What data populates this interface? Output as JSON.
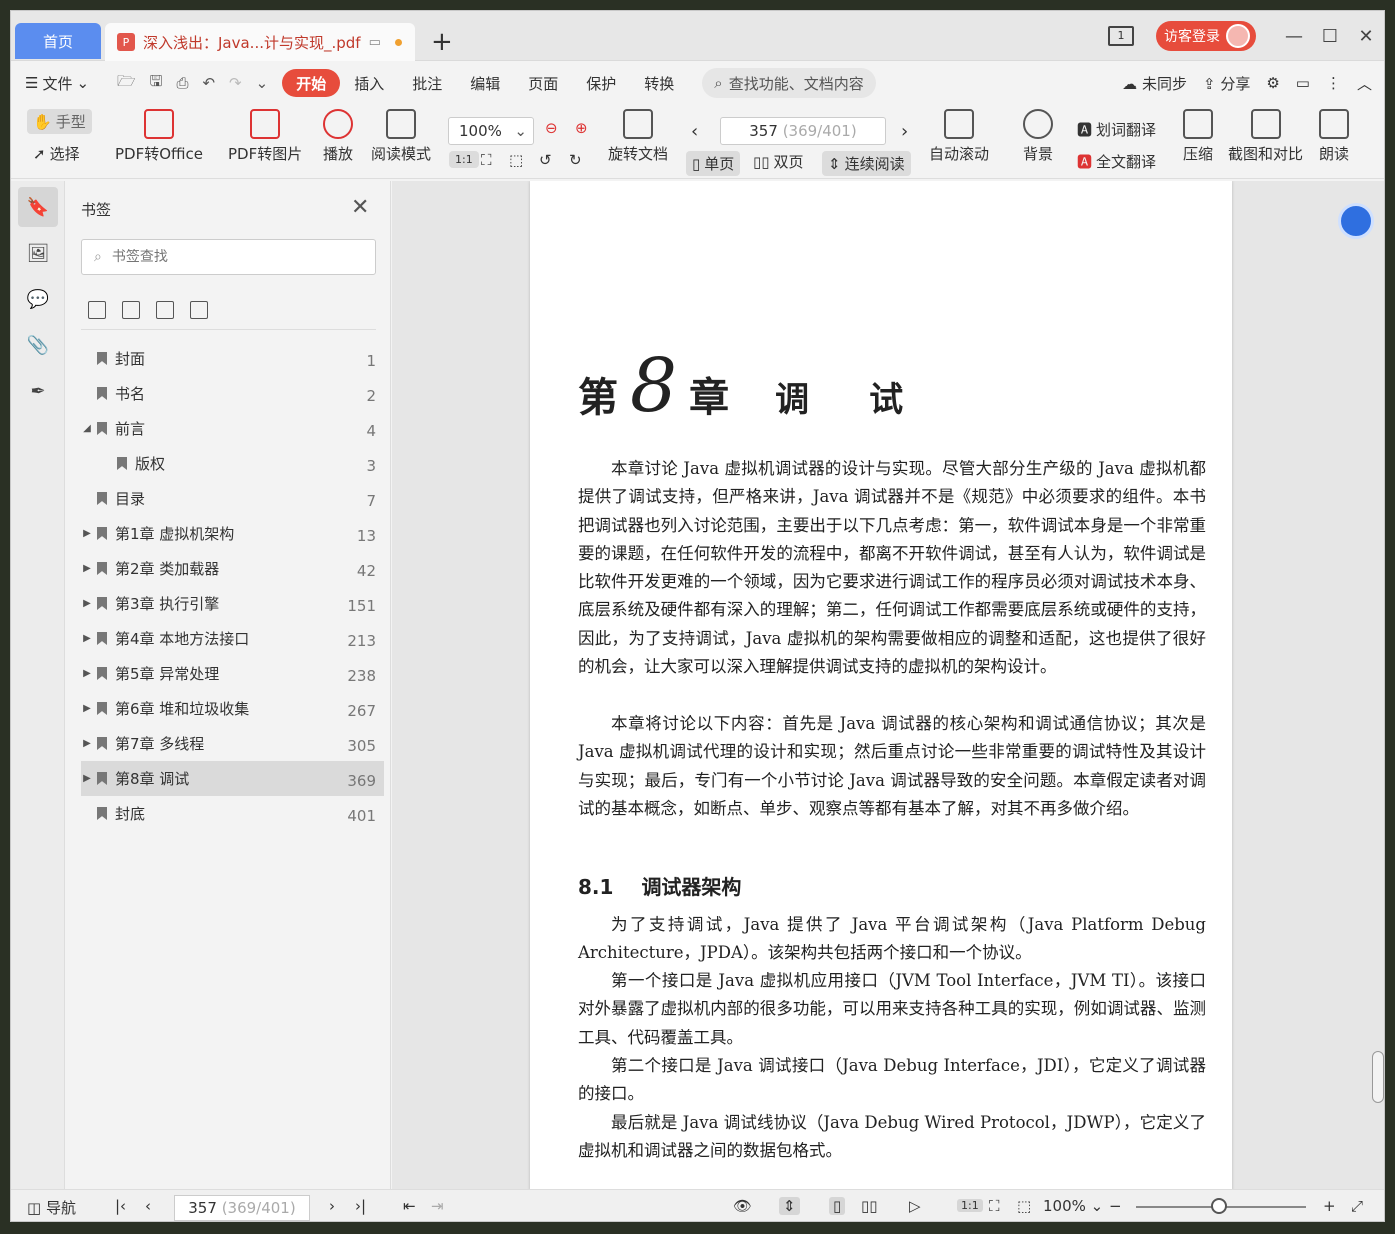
{
  "titlebar": {
    "home_tab": "首页",
    "doc_tab": "深入浅出：Java...计与实现_.pdf",
    "login": "访客登录",
    "doc_count": "1"
  },
  "menubar": {
    "file": "文件",
    "tabs": [
      "开始",
      "插入",
      "批注",
      "编辑",
      "页面",
      "保护",
      "转换"
    ],
    "search_placeholder": "查找功能、文档内容",
    "sync": "未同步",
    "share": "分享"
  },
  "ribbon": {
    "hand": "手型",
    "select": "选择",
    "pdf_to_office": "PDF转Office",
    "pdf_to_image": "PDF转图片",
    "play": "播放",
    "read_mode": "阅读模式",
    "zoom": "100%",
    "rotate": "旋转文档",
    "page_current": "357",
    "page_total": "(369/401)",
    "single": "单页",
    "double": "双页",
    "continuous": "连续阅读",
    "auto_scroll": "自动滚动",
    "background": "背景",
    "word_translate": "划词翻译",
    "full_translate": "全文翻译",
    "compress": "压缩",
    "screenshot": "截图和对比",
    "read_aloud": "朗读"
  },
  "panel": {
    "title": "书签",
    "search_placeholder": "书签查找",
    "bookmarks": [
      {
        "label": "封面",
        "page": "1",
        "indent": 0,
        "arrow": ""
      },
      {
        "label": "书名",
        "page": "2",
        "indent": 0,
        "arrow": ""
      },
      {
        "label": "前言",
        "page": "4",
        "indent": 0,
        "arrow": "◢"
      },
      {
        "label": "版权",
        "page": "3",
        "indent": 1,
        "arrow": ""
      },
      {
        "label": "目录",
        "page": "7",
        "indent": 0,
        "arrow": ""
      },
      {
        "label": "第1章 虚拟机架构",
        "page": "13",
        "indent": 0,
        "arrow": "▶"
      },
      {
        "label": "第2章 类加载器",
        "page": "42",
        "indent": 0,
        "arrow": "▶"
      },
      {
        "label": "第3章 执行引擎",
        "page": "151",
        "indent": 0,
        "arrow": "▶"
      },
      {
        "label": "第4章 本地方法接口",
        "page": "213",
        "indent": 0,
        "arrow": "▶"
      },
      {
        "label": "第5章 异常处理",
        "page": "238",
        "indent": 0,
        "arrow": "▶"
      },
      {
        "label": "第6章 堆和垃圾收集",
        "page": "267",
        "indent": 0,
        "arrow": "▶"
      },
      {
        "label": "第7章 多线程",
        "page": "305",
        "indent": 0,
        "arrow": "▶"
      },
      {
        "label": "第8章 调试",
        "page": "369",
        "indent": 0,
        "arrow": "▶",
        "selected": true
      },
      {
        "label": "封底",
        "page": "401",
        "indent": 0,
        "arrow": ""
      }
    ]
  },
  "page": {
    "chapter_pre": "第",
    "chapter_num": "8",
    "chapter_post": "章",
    "chapter_name": "调试",
    "p1": "本章讨论 Java 虚拟机调试器的设计与实现。尽管大部分生产级的 Java 虚拟机都提供了调试支持，但严格来讲，Java 调试器并不是《规范》中必须要求的组件。本书把调试器也列入讨论范围，主要出于以下几点考虑：第一，软件调试本身是一个非常重要的课题，在任何软件开发的流程中，都离不开软件调试，甚至有人认为，软件调试是比软件开发更难的一个领域，因为它要求进行调试工作的程序员必须对调试技术本身、底层系统及硬件都有深入的理解；第二，任何调试工作都需要底层系统或硬件的支持，因此，为了支持调试，Java 虚拟机的架构需要做相应的调整和适配，这也提供了很好的机会，让大家可以深入理解提供调试支持的虚拟机的架构设计。",
    "p2": "本章将讨论以下内容：首先是 Java 调试器的核心架构和调试通信协议；其次是 Java 虚拟机调试代理的设计和实现；然后重点讨论一些非常重要的调试特性及其设计与实现；最后，专门有一个小节讨论 Java 调试器导致的安全问题。本章假定读者对调试的基本概念，如断点、单步、观察点等都有基本了解，对其不再多做介绍。",
    "sec_num": "8.1",
    "sec_title": "调试器架构",
    "p3": "为了支持调试，Java 提供了 Java 平台调试架构（Java Platform Debug Architecture，JPDA）。该架构共包括两个接口和一个协议。",
    "p4": "第一个接口是 Java 虚拟机应用接口（JVM Tool Interface，JVM TI）。该接口对外暴露了虚拟机内部的很多功能，可以用来支持各种工具的实现，例如调试器、监测工具、代码覆盖工具。",
    "p5": "第二个接口是 Java 调试接口（Java Debug Interface，JDI），它定义了调试器的接口。",
    "p6": "最后就是 Java 调试线协议（Java Debug Wired Protocol，JDWP），它定义了虚拟机和调试器之间的数据包格式。"
  },
  "statusbar": {
    "nav": "导航",
    "page_current": "357",
    "page_total": "(369/401)",
    "zoom": "100%"
  }
}
